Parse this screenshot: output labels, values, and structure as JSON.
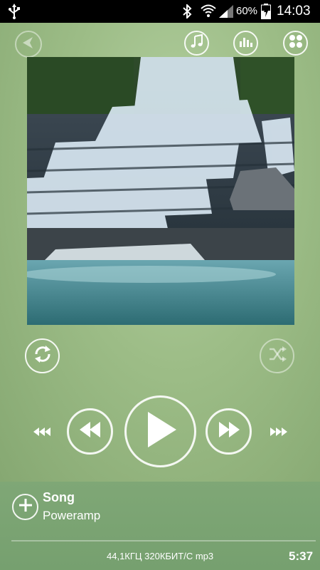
{
  "status_bar": {
    "battery_percent": "60%",
    "time": "14:03",
    "icons": [
      "usb-icon",
      "bluetooth-icon",
      "wifi-icon",
      "signal-icon",
      "battery-charging-icon"
    ]
  },
  "top_controls": {
    "back_icon": "back-arrow-icon",
    "library_icon": "music-note-icon",
    "equalizer_icon": "equalizer-icon",
    "menu_icon": "four-dots-icon"
  },
  "playback_controls": {
    "repeat_icon": "repeat-icon",
    "shuffle_icon": "shuffle-icon",
    "prev_category_icon": "triple-left-arrow-icon",
    "rewind_icon": "rewind-icon",
    "play_icon": "play-icon",
    "forward_icon": "fast-forward-icon",
    "next_category_icon": "triple-right-arrow-icon"
  },
  "track": {
    "title": "Song",
    "artist": "Poweramp",
    "audio_info": "44,1КГЦ  320КБИТ/С  mp3",
    "duration": "5:37",
    "progress": 0.0
  },
  "colors": {
    "background": "#9dbd87",
    "bottom_panel": "#7fa776",
    "status_bar": "#000000",
    "foreground": "#ffffff"
  }
}
